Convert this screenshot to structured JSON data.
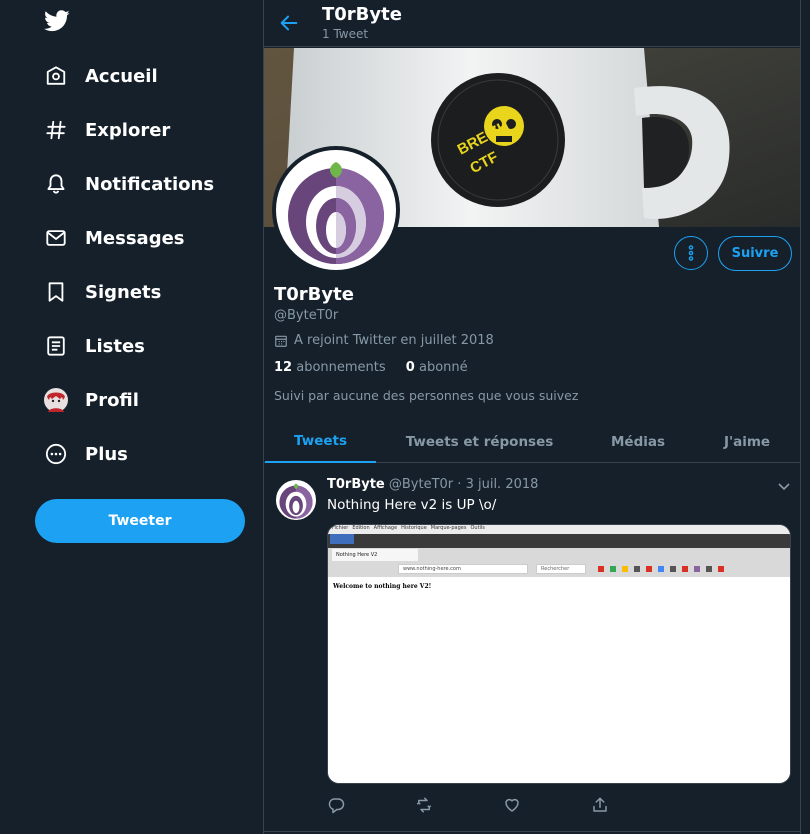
{
  "colors": {
    "background": "#15202b",
    "accent": "#1da1f2",
    "muted": "#8899a6",
    "border": "#38444d"
  },
  "sidebar": {
    "logo_icon": "twitter-bird-icon",
    "items": [
      {
        "label": "Accueil",
        "icon": "home-icon"
      },
      {
        "label": "Explorer",
        "icon": "hashtag-icon"
      },
      {
        "label": "Notifications",
        "icon": "bell-icon"
      },
      {
        "label": "Messages",
        "icon": "envelope-icon"
      },
      {
        "label": "Signets",
        "icon": "bookmark-icon"
      },
      {
        "label": "Listes",
        "icon": "list-icon"
      },
      {
        "label": "Profil",
        "icon": "avatar-icon"
      },
      {
        "label": "Plus",
        "icon": "more-circle-icon"
      }
    ],
    "tweet_button": "Tweeter"
  },
  "header": {
    "title": "T0rByte",
    "subtitle": "1 Tweet"
  },
  "profile": {
    "name": "T0rByte",
    "handle": "@ByteT0r",
    "joined": "A rejoint Twitter en juillet 2018",
    "following_count": "12",
    "following_label": "abonnements",
    "followers_count": "0",
    "followers_label": "abonné",
    "followed_by": "Suivi par aucune des personnes que vous suivez",
    "follow_button": "Suivre",
    "banner_sticker_text": [
      "BREIZH",
      "CTF"
    ]
  },
  "tabs": [
    "Tweets",
    "Tweets et réponses",
    "Médias",
    "J'aime"
  ],
  "tweet": {
    "name": "T0rByte",
    "handle": "@ByteT0r",
    "separator": "·",
    "date": "3 juil. 2018",
    "text": "Nothing Here v2 is UP \\o/",
    "media": {
      "menu": [
        "Fichier",
        "Édition",
        "Affichage",
        "Historique",
        "Marque-pages",
        "Outils"
      ],
      "tab_title": "Nothing Here V2",
      "url": "www.nothing-here.com",
      "search_placeholder": "Rechercher",
      "page_text": "Welcome to nothing here V2!"
    }
  }
}
